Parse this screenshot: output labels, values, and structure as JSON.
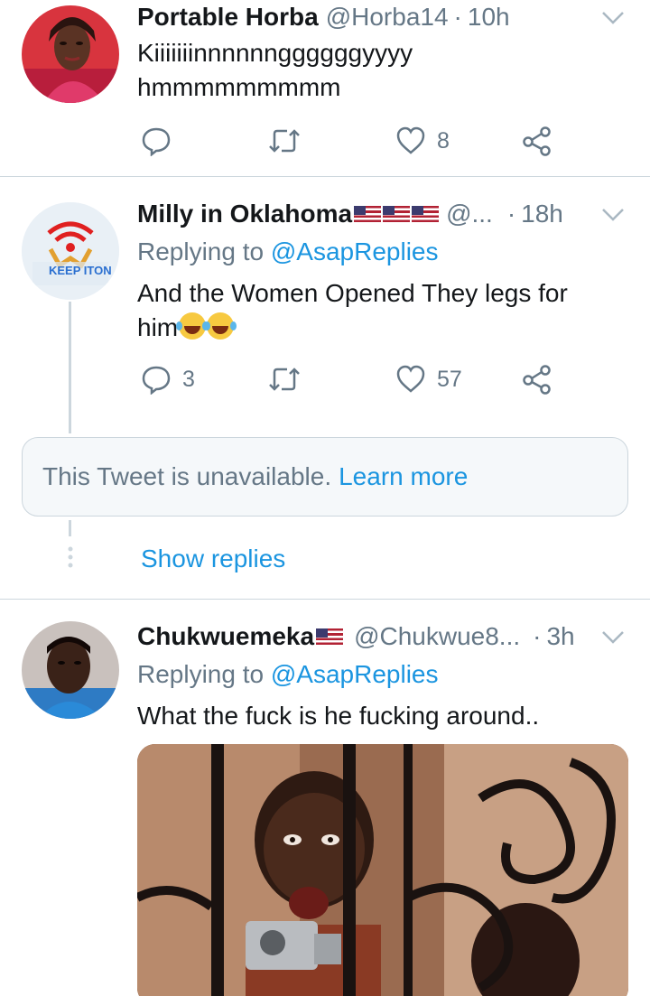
{
  "tweets": [
    {
      "name": "Portable Horba",
      "handle": "@Horba14",
      "separator": "·",
      "time": "10h",
      "text_line1": "Kiiiiiiinnnnnnggggggyyyy",
      "text_line2": "hmmmmmmmmm",
      "reply_count": "",
      "retweet_count": "",
      "like_count": "8"
    },
    {
      "name": "Milly in Oklahoma",
      "handle": "@...",
      "separator": "·",
      "time": "18h",
      "replying_prefix": "Replying to",
      "replying_handle": "@AsapReplies",
      "text_line1": "And the Women Opened They legs for",
      "text_line2": "him",
      "reply_count": "3",
      "retweet_count": "",
      "like_count": "57"
    },
    {
      "name": "Chukwuemeka",
      "handle": "@Chukwue8...",
      "separator": "·",
      "time": "3h",
      "replying_prefix": "Replying to",
      "replying_handle": "@AsapReplies",
      "text_line1": "What the fuck is he fucking around.."
    }
  ],
  "unavailable_notice": {
    "text": "This Tweet is unavailable.",
    "link": "Learn more"
  },
  "show_replies_label": "Show replies",
  "avatar_logo_text": "KEEP ITON",
  "icons": [
    "reply-icon",
    "retweet-icon",
    "like-icon",
    "share-icon",
    "chevron-down-icon",
    "us-flag-icon",
    "tears-of-joy-emoji"
  ],
  "colors": {
    "text": "#14171a",
    "secondary": "#657786",
    "link": "#1b95e0",
    "divider": "#ccd6dd"
  }
}
